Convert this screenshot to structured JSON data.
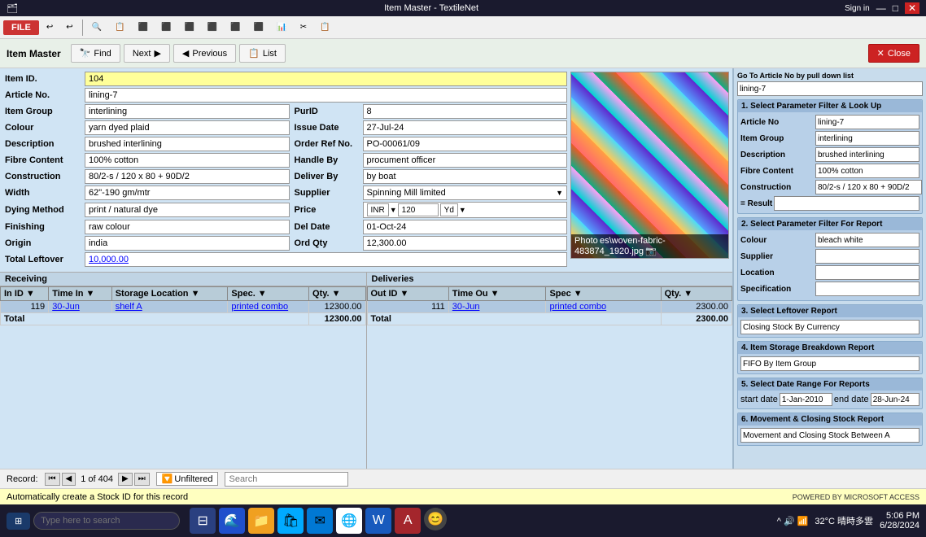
{
  "titlebar": {
    "title": "Item Master - TextileNet",
    "sign_in": "Sign in",
    "controls": [
      "?",
      "—",
      "□",
      "✕"
    ]
  },
  "toolbar": {
    "buttons": [
      "🔙",
      "✅",
      "⟳",
      "⬛",
      "⬛",
      "⬛",
      "⬛",
      "⬛",
      "⬛",
      "⬛",
      "⬛"
    ]
  },
  "ribbon": {
    "title": "Item Master",
    "find_label": "Find",
    "next_label": "Next",
    "previous_label": "Previous",
    "list_label": "List",
    "close_label": "Close"
  },
  "form": {
    "item_id_label": "Item ID.",
    "item_id_value": "104",
    "article_no_label": "Article No.",
    "article_no_value": "lining-7",
    "item_group_label": "Item Group",
    "item_group_value": "interlining",
    "pur_id_label": "PurID",
    "pur_id_value": "8",
    "colour_label": "Colour",
    "colour_value": "yarn dyed plaid",
    "issue_date_label": "Issue Date",
    "issue_date_value": "27-Jul-24",
    "description_label": "Description",
    "description_value": "brushed interlining",
    "order_ref_label": "Order Ref No.",
    "order_ref_value": "PO-00061/09",
    "fibre_content_label": "Fibre Content",
    "fibre_content_value": "100% cotton",
    "handle_by_label": "Handle By",
    "handle_by_value": "procument officer",
    "construction_label": "Construction",
    "construction_value": "80/2-s / 120 x 80 + 90D/2",
    "deliver_by_label": "Deliver By",
    "deliver_by_value": "by boat",
    "width_label": "Width",
    "width_value": "62\"-190 gm/mtr",
    "supplier_label": "Supplier",
    "supplier_value": "Spinning Mill limited",
    "dying_method_label": "Dying Method",
    "dying_method_value": "print / natural dye",
    "price_label": "Price",
    "price_currency": "INR",
    "price_amount": "120",
    "price_unit": "Yd",
    "finishing_label": "Finishing",
    "finishing_value": "raw colour",
    "del_date_label": "Del Date",
    "del_date_value": "01-Oct-24",
    "origin_label": "Origin",
    "origin_value": "india",
    "ord_qty_label": "Ord Qty",
    "ord_qty_value": "12,300.00",
    "total_leftover_label": "Total Leftover",
    "total_leftover_value": "10,000.00",
    "photo_label": "Photo",
    "photo_path": "es\\woven-fabric-483874_1920.jpg"
  },
  "receiving": {
    "title": "Receiving",
    "columns": [
      "In ID",
      "Time In",
      "Storage Location",
      "Spec.",
      "Qty."
    ],
    "rows": [
      {
        "in_id": "119",
        "time_in": "30-Jun",
        "storage": "shelf A",
        "spec": "printed combo",
        "qty": "12300.00",
        "selected": true
      }
    ],
    "total_row": {
      "label": "Total",
      "qty": "12300.00"
    }
  },
  "deliveries": {
    "title": "Deliveries",
    "columns": [
      "Out ID",
      "Time Ou",
      "Spec",
      "Qty."
    ],
    "rows": [
      {
        "out_id": "111",
        "time_out": "30-Jun",
        "spec": "printed combo",
        "qty": "2300.00",
        "selected": true
      }
    ],
    "total_row": {
      "label": "Total",
      "qty": "2300.00"
    }
  },
  "right_panel": {
    "go_to_label": "Go To Article No by pull down list",
    "go_to_value": "lining-7",
    "section1": {
      "title": "1. Select Parameter Filter & Look Up",
      "rows": [
        {
          "label": "Article No",
          "value": "lining-7"
        },
        {
          "label": "Item Group",
          "value": "interlining"
        },
        {
          "label": "Description",
          "value": "brushed interlining"
        },
        {
          "label": "Fibre Content",
          "value": "100% cotton"
        },
        {
          "label": "Construction",
          "value": "80/2-s / 120 x 80 + 90D/2"
        }
      ],
      "result_label": "= Result",
      "result_value": ""
    },
    "section2": {
      "title": "2. Select Parameter Filter For Report",
      "rows": [
        {
          "label": "Colour",
          "value": "bleach white"
        },
        {
          "label": "Supplier",
          "value": ""
        },
        {
          "label": "Location",
          "value": ""
        },
        {
          "label": "Specification",
          "value": ""
        }
      ]
    },
    "section3": {
      "title": "3. Select Leftover Report",
      "value": "Closing Stock By Currency"
    },
    "section4": {
      "title": "4. Item Storage Breakdown Report",
      "value": "FIFO By Item Group"
    },
    "section5": {
      "title": "5. Select Date Range For  Reports",
      "start_label": "start date",
      "start_value": "1-Jan-2010",
      "end_label": "end date",
      "end_value": "28-Jun-24"
    },
    "section6": {
      "title": "6. Movement & Closing Stock Report",
      "value": "Movement and Closing Stock Between A"
    }
  },
  "status_bar": {
    "record_label": "Record:",
    "nav_first": "⏮",
    "nav_prev": "◀",
    "record_info": "1 of 404",
    "nav_next": "▶",
    "nav_last": "⏭",
    "unfiltered": "Unfiltered",
    "search_placeholder": "Search"
  },
  "bottom_status": {
    "message": "Automatically create a Stock ID for this record",
    "powered_by": "POWERED BY MICROSOFT ACCESS"
  },
  "taskbar": {
    "start_label": "⊞",
    "search_placeholder": "Type here to search",
    "time": "5:06 PM",
    "date": "6/28/2024",
    "weather": "32°C 晴時多雲"
  }
}
